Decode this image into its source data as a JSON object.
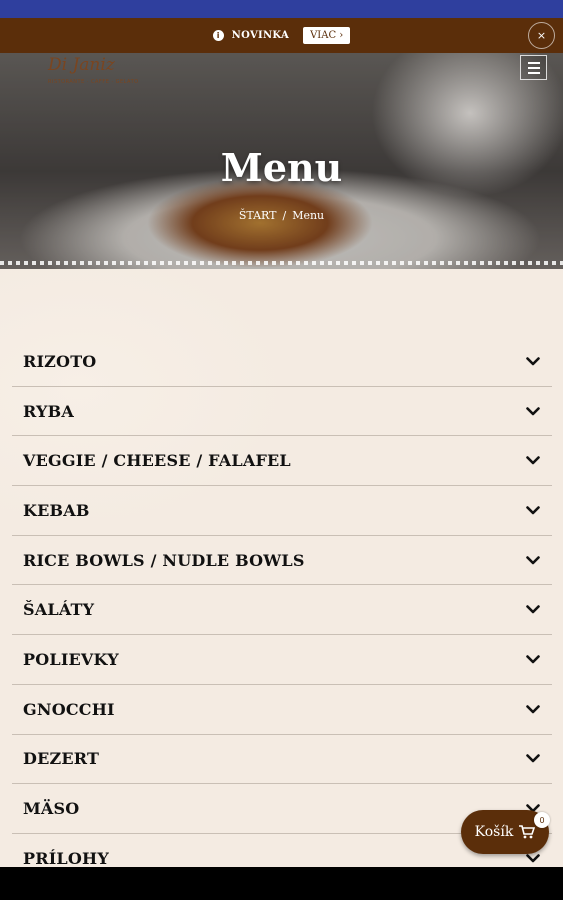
{
  "notice": {
    "icon": "info-icon",
    "text": "NOVINKA",
    "more_label": "VIAC ›",
    "close_label": "×"
  },
  "header": {
    "logo_text": "Di Janiz",
    "logo_subtitle": "RISTORANTE · CAFFE · GELATO",
    "menu_icon": "hamburger-menu-icon"
  },
  "hero": {
    "title": "Menu",
    "breadcrumb": {
      "home": "ŠTART",
      "separator": "/",
      "current": "Menu"
    }
  },
  "menu": {
    "items": [
      {
        "label": "RIZOTO"
      },
      {
        "label": "RYBA"
      },
      {
        "label": "VEGGIE / CHEESE / FALAFEL"
      },
      {
        "label": "KEBAB"
      },
      {
        "label": "RICE BOWLS / NUDLE BOWLS"
      },
      {
        "label": "ŠALÁTY"
      },
      {
        "label": "POLIEVKY"
      },
      {
        "label": "GNOCCHI"
      },
      {
        "label": "DEZERT"
      },
      {
        "label": "MÄSO"
      },
      {
        "label": "PRÍLOHY"
      }
    ]
  },
  "cart": {
    "label": "Košík",
    "count": "0",
    "icon": "cart-icon"
  },
  "colors": {
    "brand_brown": "#5b2e0a",
    "status_bar_blue": "#2f3f9e",
    "content_bg": "#f4ebe2"
  }
}
